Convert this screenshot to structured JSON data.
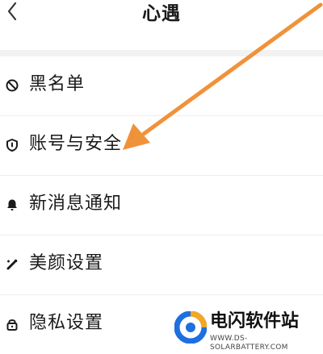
{
  "header": {
    "title": "心遇",
    "back_icon": "chevron-left-icon"
  },
  "settings": {
    "items": [
      {
        "icon": "block-icon",
        "label": "黑名单"
      },
      {
        "icon": "shield-icon",
        "label": "账号与安全"
      },
      {
        "icon": "bell-icon",
        "label": "新消息通知"
      },
      {
        "icon": "beauty-wand-icon",
        "label": "美颜设置"
      },
      {
        "icon": "lock-icon",
        "label": "隐私设置"
      }
    ]
  },
  "annotation": {
    "arrow_color": "#f0923a"
  },
  "watermark": {
    "name": "电闪软件站",
    "url": "WWW.DS-SOLARBATTERY.COM",
    "logo_colors": [
      "#1e6fe0",
      "#f5a623"
    ]
  }
}
